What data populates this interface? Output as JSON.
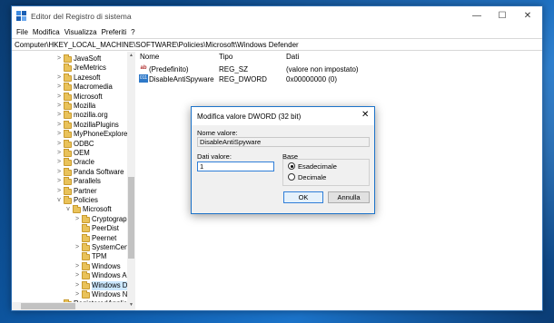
{
  "window": {
    "title": "Editor del Registro di sistema",
    "controls": {
      "minimize": "—",
      "maximize": "☐",
      "close": "✕"
    }
  },
  "menu": [
    "File",
    "Modifica",
    "Visualizza",
    "Preferiti",
    "?"
  ],
  "address": "Computer\\HKEY_LOCAL_MACHINE\\SOFTWARE\\Policies\\Microsoft\\Windows Defender",
  "tree": [
    {
      "label": "JavaSoft",
      "level": 1,
      "expander": ">"
    },
    {
      "label": "JreMetrics",
      "level": 1,
      "expander": ""
    },
    {
      "label": "Lazesoft",
      "level": 1,
      "expander": ">"
    },
    {
      "label": "Macromedia",
      "level": 1,
      "expander": ">"
    },
    {
      "label": "Microsoft",
      "level": 1,
      "expander": ">"
    },
    {
      "label": "Mozilla",
      "level": 1,
      "expander": ">"
    },
    {
      "label": "mozilla.org",
      "level": 1,
      "expander": ">"
    },
    {
      "label": "MozillaPlugins",
      "level": 1,
      "expander": ">"
    },
    {
      "label": "MyPhoneExplorer",
      "level": 1,
      "expander": ">"
    },
    {
      "label": "ODBC",
      "level": 1,
      "expander": ">"
    },
    {
      "label": "OEM",
      "level": 1,
      "expander": ">"
    },
    {
      "label": "Oracle",
      "level": 1,
      "expander": ">"
    },
    {
      "label": "Panda Software",
      "level": 1,
      "expander": ">"
    },
    {
      "label": "Parallels",
      "level": 1,
      "expander": ">"
    },
    {
      "label": "Partner",
      "level": 1,
      "expander": ">"
    },
    {
      "label": "Policies",
      "level": 1,
      "expander": "v"
    },
    {
      "label": "Microsoft",
      "level": 2,
      "expander": "v"
    },
    {
      "label": "Cryptography",
      "level": 3,
      "expander": ">"
    },
    {
      "label": "PeerDist",
      "level": 3,
      "expander": ""
    },
    {
      "label": "Peernet",
      "level": 3,
      "expander": ""
    },
    {
      "label": "SystemCertificates",
      "level": 3,
      "expander": ">"
    },
    {
      "label": "TPM",
      "level": 3,
      "expander": ""
    },
    {
      "label": "Windows",
      "level": 3,
      "expander": ">"
    },
    {
      "label": "Windows Advanced Threat Protection",
      "level": 3,
      "expander": ">"
    },
    {
      "label": "Windows Defender",
      "level": 3,
      "expander": ">",
      "selected": true
    },
    {
      "label": "Windows NT",
      "level": 3,
      "expander": ">"
    },
    {
      "label": "RegisteredApplications",
      "level": 1,
      "expander": ""
    }
  ],
  "list": {
    "headers": {
      "name": "Nome",
      "type": "Tipo",
      "data": "Dati"
    },
    "rows": [
      {
        "icon": "ab",
        "iconKind": "sz",
        "name": "(Predefinito)",
        "type": "REG_SZ",
        "data": "(valore non impostato)"
      },
      {
        "icon": "011",
        "iconKind": "dw",
        "name": "DisableAntiSpyware",
        "type": "REG_DWORD",
        "data": "0x00000000 (0)"
      }
    ]
  },
  "dialog": {
    "title": "Modifica valore DWORD (32 bit)",
    "close": "✕",
    "name_label": "Nome valore:",
    "name_value": "DisableAntiSpyware",
    "data_label": "Dati valore:",
    "data_value": "1",
    "base_label": "Base",
    "radio_hex": "Esadecimale",
    "radio_dec": "Decimale",
    "ok": "OK",
    "cancel": "Annulla"
  },
  "scroll": {
    "up": "▲",
    "down": "▼"
  }
}
